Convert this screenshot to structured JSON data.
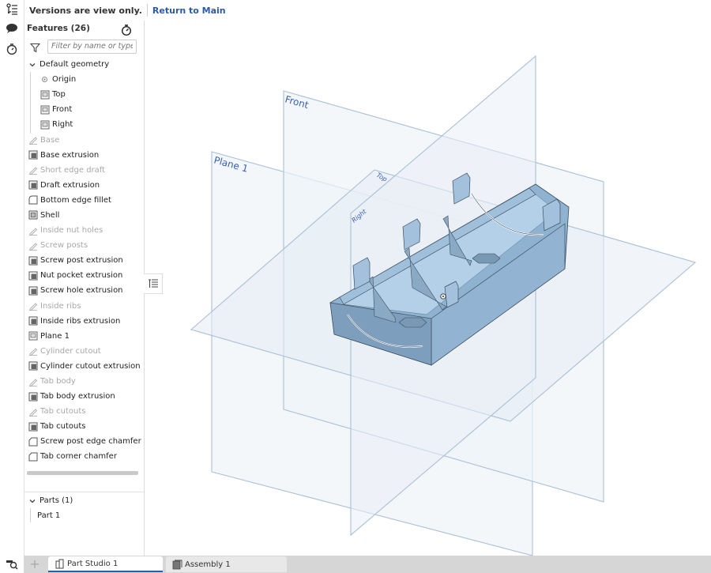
{
  "topbar": {
    "version_notice": "Versions are view only.",
    "return_link": "Return to Main"
  },
  "left_toolbar": {
    "icons": [
      "feature-list-icon",
      "comments-icon",
      "performance-timer-icon"
    ],
    "bottom_icon": "view-search-icon"
  },
  "feature_panel": {
    "title": "Features (26)",
    "filter_placeholder": "Filter by name or type",
    "default_geometry": {
      "label": "Default geometry",
      "items": [
        {
          "label": "Origin",
          "icon": "origin-icon"
        },
        {
          "label": "Top",
          "icon": "plane-icon"
        },
        {
          "label": "Front",
          "icon": "plane-icon"
        },
        {
          "label": "Right",
          "icon": "plane-icon"
        }
      ]
    },
    "features": [
      {
        "label": "Base",
        "icon": "sketch-icon",
        "dim": true
      },
      {
        "label": "Base extrusion",
        "icon": "extrude-icon",
        "dim": false
      },
      {
        "label": "Short edge draft",
        "icon": "sketch-icon",
        "dim": true
      },
      {
        "label": "Draft extrusion",
        "icon": "extrude-icon",
        "dim": false
      },
      {
        "label": "Bottom edge fillet",
        "icon": "fillet-icon",
        "dim": false
      },
      {
        "label": "Shell",
        "icon": "shell-icon",
        "dim": false
      },
      {
        "label": "Inside nut holes",
        "icon": "sketch-icon",
        "dim": true
      },
      {
        "label": "Screw posts",
        "icon": "sketch-icon",
        "dim": true
      },
      {
        "label": "Screw post extrusion",
        "icon": "extrude-icon",
        "dim": false
      },
      {
        "label": "Nut pocket extrusion",
        "icon": "extrude-icon",
        "dim": false
      },
      {
        "label": "Screw hole extrusion",
        "icon": "extrude-icon",
        "dim": false
      },
      {
        "label": "Inside ribs",
        "icon": "sketch-icon",
        "dim": true
      },
      {
        "label": "Inside ribs extrusion",
        "icon": "extrude-icon",
        "dim": false
      },
      {
        "label": "Plane 1",
        "icon": "plane-icon",
        "dim": false
      },
      {
        "label": "Cylinder cutout",
        "icon": "sketch-icon",
        "dim": true
      },
      {
        "label": "Cylinder cutout extrusion",
        "icon": "extrude-icon",
        "dim": false
      },
      {
        "label": "Tab body",
        "icon": "sketch-icon",
        "dim": true
      },
      {
        "label": "Tab body extrusion",
        "icon": "extrude-icon",
        "dim": false
      },
      {
        "label": "Tab cutouts",
        "icon": "sketch-icon",
        "dim": true
      },
      {
        "label": "Tab cutouts",
        "icon": "extrude-icon",
        "dim": false
      },
      {
        "label": "Screw post edge chamfer",
        "icon": "chamfer-icon",
        "dim": false
      },
      {
        "label": "Tab corner chamfer",
        "icon": "chamfer-icon",
        "dim": false
      }
    ],
    "parts": {
      "label": "Parts (1)",
      "items": [
        "Part 1"
      ]
    }
  },
  "viewport": {
    "plane_labels": {
      "front": "Front",
      "plane1": "Plane 1",
      "top": "Top",
      "right": "Right"
    },
    "colors": {
      "plane_stroke": "#a9bfd6",
      "plane_fill": "#eef3f8",
      "part_light": "#a9c8e2",
      "part_mid": "#8fb2d1",
      "part_dark": "#6f93b3",
      "label": "#3a5fb0"
    }
  },
  "bottom_tabs": {
    "add_label": "+",
    "tabs": [
      {
        "label": "Part Studio 1",
        "icon": "part-studio-icon",
        "active": true
      },
      {
        "label": "Assembly 1",
        "icon": "assembly-icon",
        "active": false
      }
    ]
  },
  "accent_color": "#2a5aa8"
}
